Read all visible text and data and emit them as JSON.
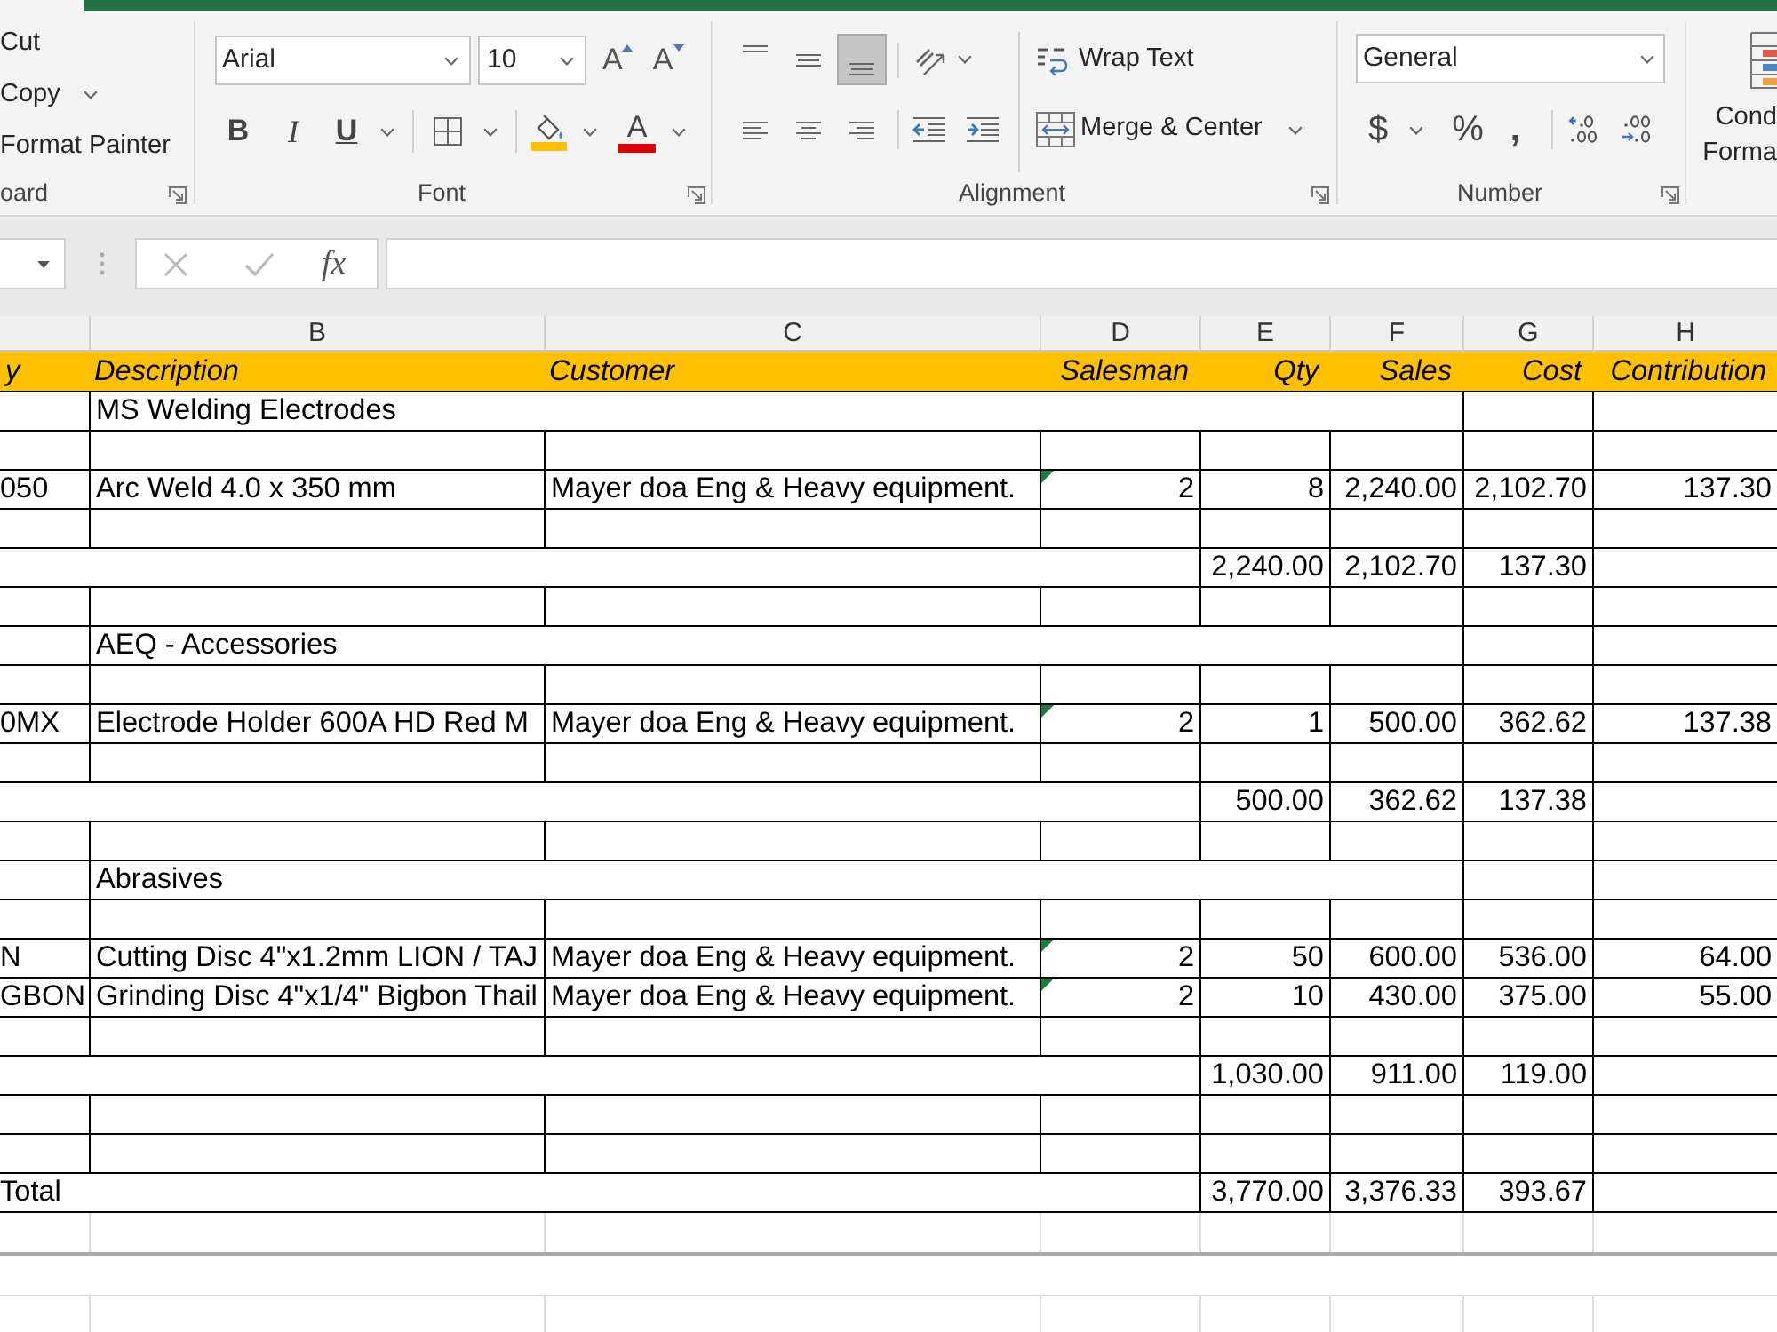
{
  "ribbon": {
    "clipboard": {
      "commands": [
        {
          "label": "Cut",
          "has_menu": false
        },
        {
          "label": "Copy",
          "has_menu": true
        },
        {
          "label": "Format Painter",
          "has_menu": false
        }
      ],
      "label": "oard"
    },
    "font": {
      "name": "Arial",
      "size": "10",
      "grow": "A",
      "shrink": "A",
      "bold": "B",
      "italic": "I",
      "underline": "U",
      "font_color": "A",
      "label": "Font"
    },
    "alignment": {
      "vertical": [
        {
          "kind": "top",
          "selected": false
        },
        {
          "kind": "middle",
          "selected": false
        },
        {
          "kind": "bottom",
          "selected": true
        }
      ],
      "horizontal": [
        {
          "kind": "left",
          "selected": false
        },
        {
          "kind": "center",
          "selected": false
        },
        {
          "kind": "right",
          "selected": false
        }
      ],
      "wrap_text": "Wrap Text",
      "merge_center": "Merge & Center",
      "label": "Alignment"
    },
    "number": {
      "format": "General",
      "currency": "$",
      "percent": "%",
      "comma": ",",
      "label": "Number"
    },
    "styles": {
      "conditional_formatting": [
        "Cond",
        "Forma"
      ]
    }
  },
  "formula_bar": {
    "function_label": "fx"
  },
  "sheet": {
    "column_headers": [
      "B",
      "C",
      "D",
      "E",
      "F",
      "G",
      "H"
    ],
    "header_row": [
      "y",
      "Description",
      "Customer",
      "Salesman",
      "Qty",
      "Sales",
      "Cost",
      "Contribution"
    ],
    "rows": [
      {
        "kind": "group",
        "title": "MS Welding Electrodes"
      },
      {
        "kind": "blank"
      },
      {
        "kind": "item",
        "cells": [
          "050",
          "Arc Weld 4.0 x 350 mm",
          "Mayer doa Eng & Heavy equipment.",
          "2",
          "8",
          "2,240.00",
          "2,102.70",
          "137.30"
        ],
        "error_flag": true
      },
      {
        "kind": "blank"
      },
      {
        "kind": "subtotal",
        "values": [
          "2,240.00",
          "2,102.70",
          "137.30"
        ]
      },
      {
        "kind": "blank"
      },
      {
        "kind": "group",
        "title": "AEQ - Accessories"
      },
      {
        "kind": "blank"
      },
      {
        "kind": "item",
        "cells": [
          "0MX",
          "Electrode Holder 600A HD Red M",
          "Mayer doa Eng & Heavy equipment.",
          "2",
          "1",
          "500.00",
          "362.62",
          "137.38"
        ],
        "error_flag": true
      },
      {
        "kind": "blank"
      },
      {
        "kind": "subtotal",
        "values": [
          "500.00",
          "362.62",
          "137.38"
        ]
      },
      {
        "kind": "blank"
      },
      {
        "kind": "group",
        "title": "Abrasives"
      },
      {
        "kind": "blank"
      },
      {
        "kind": "item",
        "cells": [
          "N",
          "Cutting Disc 4\"x1.2mm LION / TAJ",
          "Mayer doa Eng & Heavy equipment.",
          "2",
          "50",
          "600.00",
          "536.00",
          "64.00"
        ],
        "error_flag": true
      },
      {
        "kind": "item",
        "cells": [
          "GBON",
          "Grinding Disc 4\"x1/4\" Bigbon Thail",
          "Mayer doa Eng & Heavy equipment.",
          "2",
          "10",
          "430.00",
          "375.00",
          "55.00"
        ],
        "error_flag": true
      },
      {
        "kind": "blank"
      },
      {
        "kind": "subtotal",
        "values": [
          "1,030.00",
          "911.00",
          "119.00"
        ]
      },
      {
        "kind": "blank"
      },
      {
        "kind": "blank"
      },
      {
        "kind": "total",
        "label": "Total",
        "values": [
          "3,770.00",
          "3,376.33",
          "393.67"
        ]
      }
    ]
  }
}
